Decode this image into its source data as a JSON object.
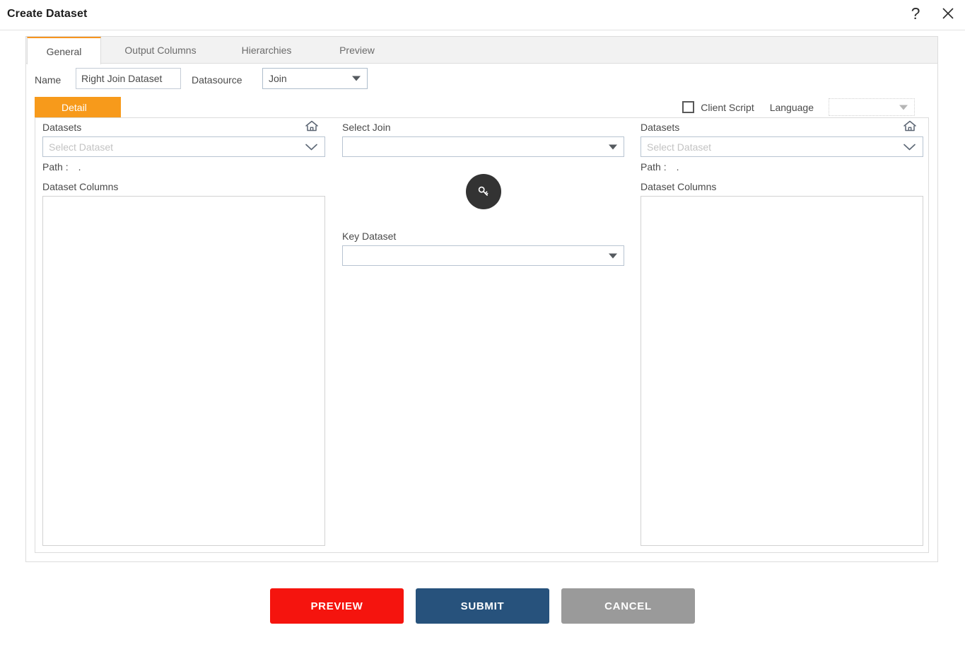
{
  "dialog": {
    "title": "Create Dataset",
    "help_icon": "help-question-icon",
    "close_icon": "close-x-icon"
  },
  "tabs": [
    {
      "id": "general",
      "label": "General",
      "active": true
    },
    {
      "id": "output-columns",
      "label": "Output Columns",
      "active": false
    },
    {
      "id": "hierarchies",
      "label": "Hierarchies",
      "active": false
    },
    {
      "id": "preview",
      "label": "Preview",
      "active": false
    }
  ],
  "form": {
    "name_label": "Name",
    "name_value": "Right Join Dataset",
    "datasource_label": "Datasource",
    "datasource_value": "Join",
    "detail_tab_label": "Detail",
    "client_script_label": "Client Script",
    "client_script_checked": false,
    "language_label": "Language",
    "language_value": ""
  },
  "left_panel": {
    "datasets_label": "Datasets",
    "home_icon": "home-icon",
    "dataset_placeholder": "Select Dataset",
    "dataset_value": "",
    "path_label": "Path :",
    "path_value": ".",
    "columns_label": "Dataset Columns",
    "columns": []
  },
  "middle_panel": {
    "select_join_label": "Select Join",
    "select_join_value": "",
    "key_icon": "key-icon",
    "key_dataset_label": "Key Dataset",
    "key_dataset_value": ""
  },
  "right_panel": {
    "datasets_label": "Datasets",
    "home_icon": "home-icon",
    "dataset_placeholder": "Select Dataset",
    "dataset_value": "",
    "path_label": "Path :",
    "path_value": ".",
    "columns_label": "Dataset Columns",
    "columns": []
  },
  "footer": {
    "preview_label": "PREVIEW",
    "submit_label": "SUBMIT",
    "cancel_label": "CANCEL"
  },
  "colors": {
    "accent_orange": "#f79a1b",
    "preview_red": "#f5140e",
    "submit_blue": "#27527c",
    "cancel_gray": "#9a9a9a",
    "key_circle": "#333333"
  }
}
